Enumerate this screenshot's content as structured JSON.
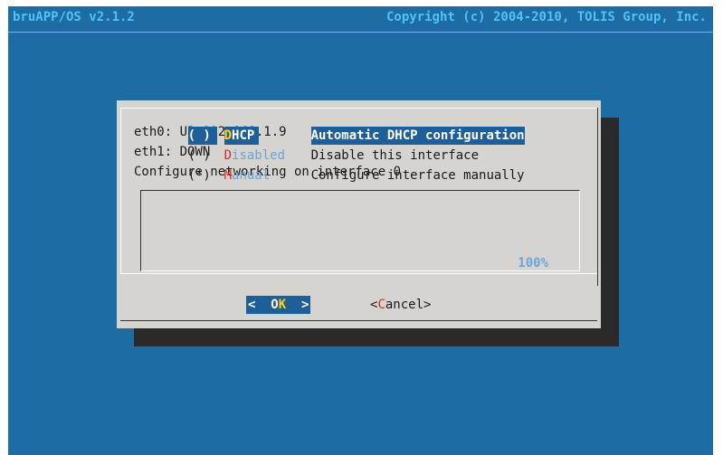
{
  "topbar": {
    "left": "bruAPP/OS v2.1.2",
    "right": "Copyright (c) 2004-2010, TOLIS Group, Inc."
  },
  "dialog": {
    "lines": [
      "eth0: UP 192.168.1.9",
      "eth1: DOWN",
      "Configure networking on interface 0"
    ],
    "options": [
      {
        "radio": "( )",
        "hotkey": "D",
        "rest": "HCP",
        "description": "Automatic DHCP configuration",
        "selected": true
      },
      {
        "radio": "( )",
        "hotkey": "D",
        "rest": "isabled",
        "description": "Disable this interface",
        "selected": false
      },
      {
        "radio": "(*)",
        "hotkey": "M",
        "rest": "anual",
        "description": "Configure interface manually",
        "selected": false
      }
    ],
    "scroll_percent": "100%",
    "ok_button": {
      "pre": "<  ",
      "hotkey_pre": "O",
      "hotkey": "K",
      "post": "  >"
    },
    "cancel_button": {
      "pre": "<",
      "hotkey": "C",
      "post": "ancel>"
    }
  },
  "colors": {
    "background": "#1e6ca4",
    "title_text": "#4fc3f7",
    "dialog_bg": "#d6d4d0",
    "selection": "#1f5f99",
    "hotkey_red": "#d62b2b",
    "hotkey_yellow": "#ffd21a"
  }
}
